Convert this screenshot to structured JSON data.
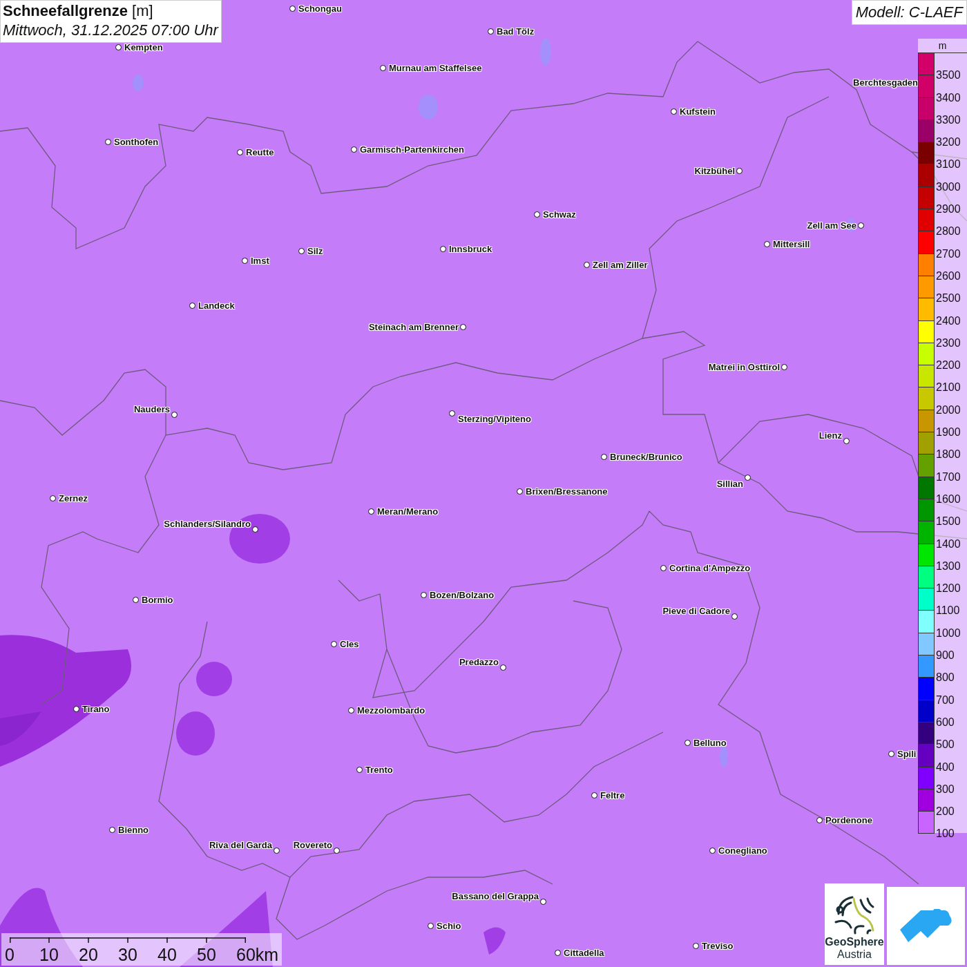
{
  "title": "**Schneefallgrenze** [m]",
  "subtitle": "Mittwoch, 31.12.2025 07:00 Uhr",
  "model": "Modell: C-LAEF",
  "legend": {
    "unit": "m",
    "steps": [
      {
        "label": "3500",
        "color": "#d4006a"
      },
      {
        "label": "3400",
        "color": "#d00068"
      },
      {
        "label": "3300",
        "color": "#c8006a"
      },
      {
        "label": "3200",
        "color": "#9a0068"
      },
      {
        "label": "3100",
        "color": "#7a0000"
      },
      {
        "label": "3000",
        "color": "#aa0000"
      },
      {
        "label": "2900",
        "color": "#c40000"
      },
      {
        "label": "2800",
        "color": "#e00000"
      },
      {
        "label": "2700",
        "color": "#ff0000"
      },
      {
        "label": "2600",
        "color": "#ff8000"
      },
      {
        "label": "2500",
        "color": "#ff9900"
      },
      {
        "label": "2400",
        "color": "#ffbb00"
      },
      {
        "label": "2300",
        "color": "#ffff00"
      },
      {
        "label": "2200",
        "color": "#c8ff00"
      },
      {
        "label": "2100",
        "color": "#c8e600"
      },
      {
        "label": "2000",
        "color": "#c8c800"
      },
      {
        "label": "1900",
        "color": "#c89600"
      },
      {
        "label": "1800",
        "color": "#a0a000"
      },
      {
        "label": "1700",
        "color": "#64a000"
      },
      {
        "label": "1600",
        "color": "#007800"
      },
      {
        "label": "1500",
        "color": "#009600"
      },
      {
        "label": "1400",
        "color": "#00b400"
      },
      {
        "label": "1300",
        "color": "#00e600"
      },
      {
        "label": "1200",
        "color": "#00ff80"
      },
      {
        "label": "1100",
        "color": "#00ffc8"
      },
      {
        "label": "1000",
        "color": "#80ffff"
      },
      {
        "label": "900",
        "color": "#80c8ff"
      },
      {
        "label": "800",
        "color": "#3399ff"
      },
      {
        "label": "700",
        "color": "#0000ff"
      },
      {
        "label": "600",
        "color": "#0000c8"
      },
      {
        "label": "500",
        "color": "#330080"
      },
      {
        "label": "400",
        "color": "#6600c0"
      },
      {
        "label": "300",
        "color": "#8000ff"
      },
      {
        "label": "200",
        "color": "#a000e0"
      },
      {
        "label": "100",
        "color": "#c864ff"
      }
    ]
  },
  "cities": [
    {
      "name": "Schongau"
    },
    {
      "name": "Bad Tölz"
    },
    {
      "name": "Kempten"
    },
    {
      "name": "Murnau am Staffelsee"
    },
    {
      "name": "Kufstein"
    },
    {
      "name": "Berchtesgaden"
    },
    {
      "name": "Sonthofen"
    },
    {
      "name": "Reutte"
    },
    {
      "name": "Garmisch-Partenkirchen"
    },
    {
      "name": "Kitzbühel"
    },
    {
      "name": "Schwaz"
    },
    {
      "name": "Zell am See"
    },
    {
      "name": "Mittersill"
    },
    {
      "name": "Innsbruck"
    },
    {
      "name": "Silz"
    },
    {
      "name": "Imst"
    },
    {
      "name": "Zell am Ziller"
    },
    {
      "name": "Landeck"
    },
    {
      "name": "Steinach am Brenner"
    },
    {
      "name": "Matrei in Osttirol"
    },
    {
      "name": "Nauders"
    },
    {
      "name": "Sterzing/Vipiteno"
    },
    {
      "name": "Lienz"
    },
    {
      "name": "Bruneck/Brunico"
    },
    {
      "name": "Sillian"
    },
    {
      "name": "Zernez"
    },
    {
      "name": "Brixen/Bressanone"
    },
    {
      "name": "Meran/Merano"
    },
    {
      "name": "Schlanders/Silandro"
    },
    {
      "name": "Cortina d'Ampezzo"
    },
    {
      "name": "Bormio"
    },
    {
      "name": "Bozen/Bolzano"
    },
    {
      "name": "Pieve di Cadore"
    },
    {
      "name": "Cles"
    },
    {
      "name": "Predazzo"
    },
    {
      "name": "Tirano"
    },
    {
      "name": "Mezzolombardo"
    },
    {
      "name": "Belluno"
    },
    {
      "name": "Spili"
    },
    {
      "name": "Trento"
    },
    {
      "name": "Feltre"
    },
    {
      "name": "Pordenone"
    },
    {
      "name": "Bienno"
    },
    {
      "name": "Riva del Garda"
    },
    {
      "name": "Rovereto"
    },
    {
      "name": "Conegliano"
    },
    {
      "name": "Bassano del Grappa"
    },
    {
      "name": "Schio"
    },
    {
      "name": "Treviso"
    },
    {
      "name": "Cittadella"
    }
  ],
  "scale_bar": {
    "labels": [
      "0",
      "10",
      "20",
      "30",
      "40",
      "50",
      "60km"
    ]
  },
  "logo": {
    "name": "GeoSphere",
    "subtitle": "Austria"
  }
}
